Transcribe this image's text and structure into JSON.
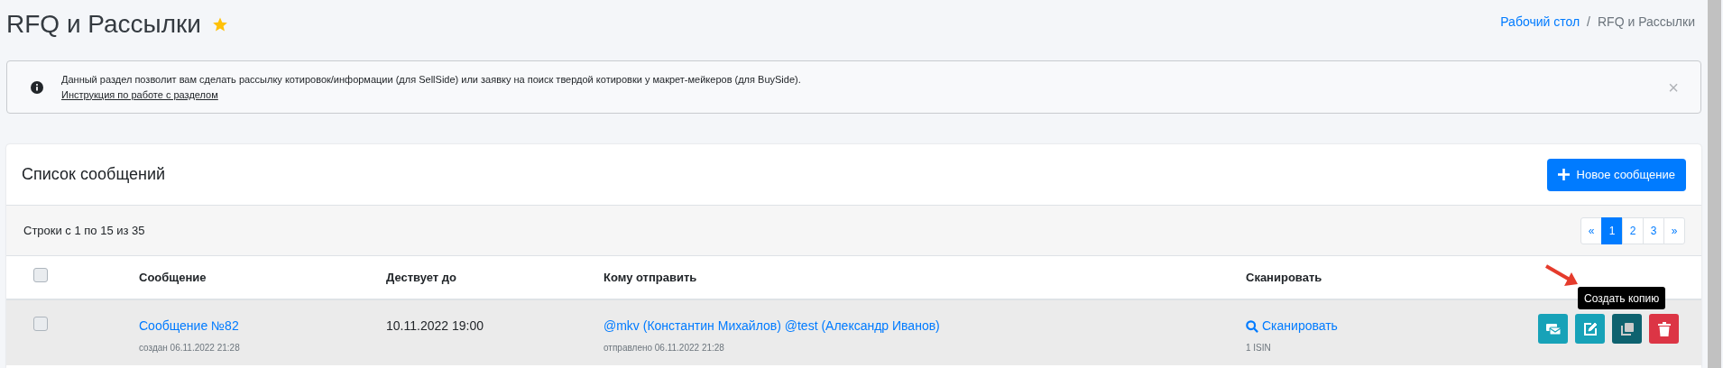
{
  "page": {
    "title": "RFQ и Рассылки",
    "favorite": true
  },
  "breadcrumb": {
    "separator": "/",
    "items": [
      {
        "label": "Рабочий стол",
        "kind": "link"
      },
      {
        "label": "RFQ и Рассылки",
        "kind": "current"
      }
    ]
  },
  "alert": {
    "text": "Данный раздел позволит вам сделать рассылку котировок/информации (для SellSide) или заявку на поиск твердой котировки у макрет-мейкеров (для BuySide).",
    "link": "Инструкция по работе с разделом",
    "close": "×"
  },
  "card": {
    "title": "Список сообщений",
    "new_button": "Новое сообщение"
  },
  "summary": "Строки с 1 по 15 из 35",
  "pagination": [
    {
      "label": "«",
      "selected": false
    },
    {
      "label": "1",
      "selected": true
    },
    {
      "label": "2",
      "selected": false
    },
    {
      "label": "3",
      "selected": false
    },
    {
      "label": "»",
      "selected": false
    }
  ],
  "table": {
    "select_all": {
      "checked": false
    },
    "columns": [
      "Сообщение",
      "Дествует до",
      "Кому отправить",
      "Сканировать"
    ],
    "rows": [
      {
        "checked": false,
        "message": "Сообщение №82",
        "created": "создан 06.11.2022 21:28",
        "valid_until": "10.11.2022 19:00",
        "recipients": "@mkv (Константин Михайлов) @test (Александр Иванов)",
        "sent": "отправлено 06.11.2022 21:28",
        "scan": "Сканировать",
        "isin": "1 ISIN",
        "actions": [
          {
            "kind": "send",
            "hovered": false
          },
          {
            "kind": "edit",
            "hovered": false
          },
          {
            "kind": "copy",
            "hovered": true
          },
          {
            "kind": "delete",
            "hovered": false
          }
        ]
      }
    ]
  },
  "tooltip": "Создать копию"
}
